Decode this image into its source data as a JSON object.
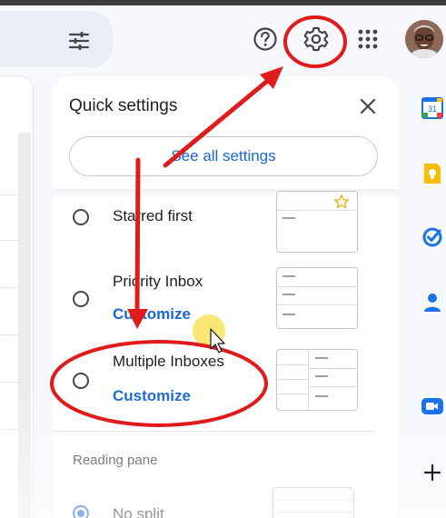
{
  "header": {
    "icons": [
      "filter-icon",
      "help-icon",
      "gear-icon",
      "apps-icon",
      "avatar"
    ]
  },
  "quick_settings": {
    "title": "Quick settings",
    "see_all_label": "See all settings",
    "inbox_types": [
      {
        "label": "Starred first",
        "customize": "",
        "selected": false
      },
      {
        "label": "Priority Inbox",
        "customize": "Customize",
        "selected": false
      },
      {
        "label": "Multiple Inboxes",
        "customize": "Customize",
        "selected": false
      }
    ],
    "reading_pane": {
      "heading": "Reading pane",
      "options": [
        {
          "label": "No split",
          "selected": true
        }
      ]
    }
  },
  "side_rail": {
    "apps": [
      "calendar-icon",
      "keep-icon",
      "tasks-icon",
      "contacts-icon",
      "meet-icon",
      "add-icon"
    ],
    "calendar_day": "31"
  },
  "annotation_colors": {
    "highlight": "#e01b1b",
    "cursor_highlight": "#f6dd4a"
  }
}
